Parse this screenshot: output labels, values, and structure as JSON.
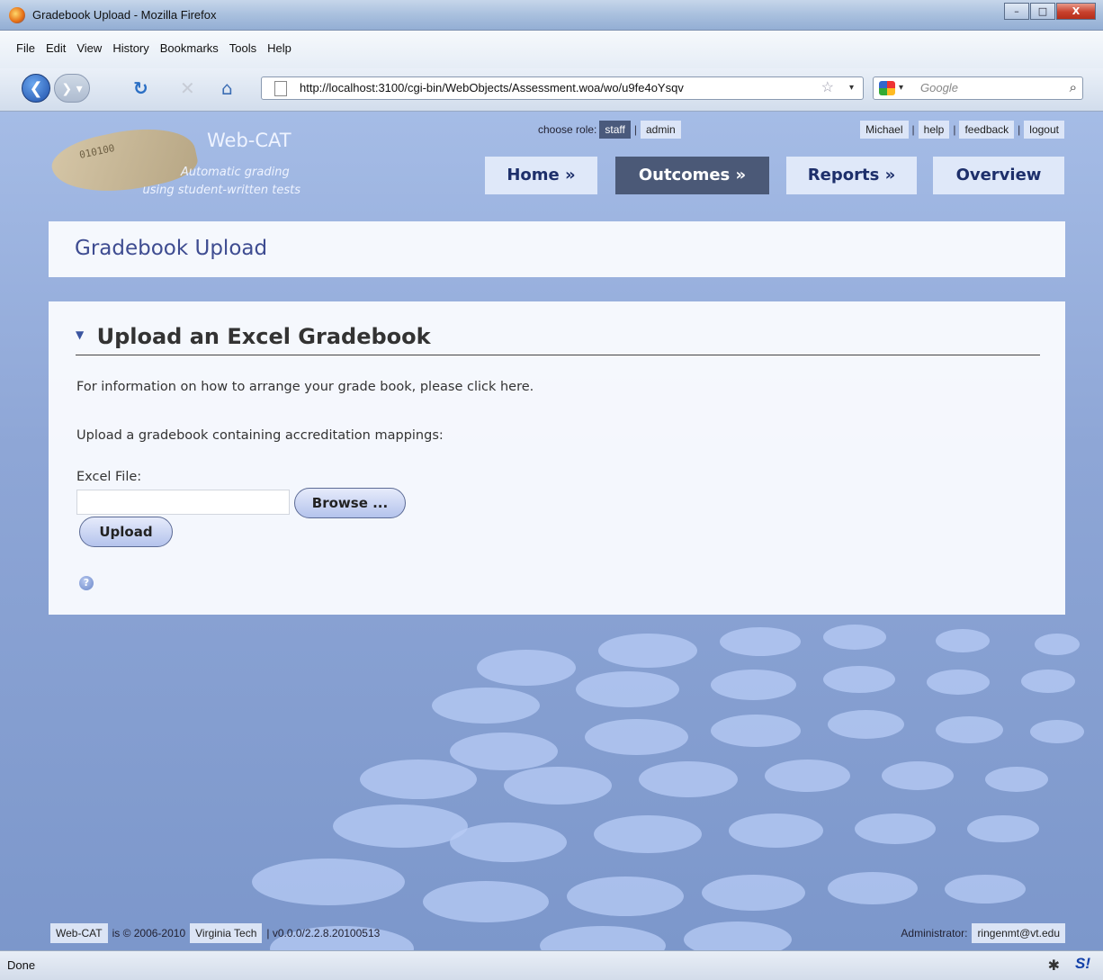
{
  "window": {
    "title": "Gradebook Upload - Mozilla Firefox",
    "controls": {
      "minimize": "–",
      "maximize": "□",
      "close": "X"
    }
  },
  "menu": [
    "File",
    "Edit",
    "View",
    "History",
    "Bookmarks",
    "Tools",
    "Help"
  ],
  "toolbar": {
    "url": "http://localhost:3100/cgi-bin/WebObjects/Assessment.woa/wo/u9fe4oYsqv",
    "search_placeholder": "Google"
  },
  "header": {
    "brand": "Web-CAT",
    "tagline_line1": "Automatic grading",
    "tagline_line2": "using student-written tests",
    "logo_code": "010100",
    "role_label": "choose role:",
    "roles": [
      "staff",
      "admin"
    ],
    "active_role": "staff",
    "user_links": [
      "Michael",
      "help",
      "feedback",
      "logout"
    ],
    "tabs": [
      "Home »",
      "Outcomes »",
      "Reports »",
      "Overview"
    ],
    "active_tab": "Outcomes »"
  },
  "page": {
    "title": "Gradebook Upload",
    "section_title": "Upload an Excel Gradebook",
    "info_text": "For information on how to arrange your grade book, please click here.",
    "upload_text": "Upload a gradebook containing accreditation mappings:",
    "file_label": "Excel File:",
    "file_value": "",
    "browse_label": "Browse ...",
    "upload_label": "Upload"
  },
  "footer": {
    "app": "Web-CAT",
    "copyright": "is © 2006-2010",
    "org": "Virginia Tech",
    "version": "| v0.0.0/2.2.8.20100513",
    "admin_label": "Administrator:",
    "admin_email": "ringenmt@vt.edu"
  },
  "status": {
    "text": "Done"
  }
}
